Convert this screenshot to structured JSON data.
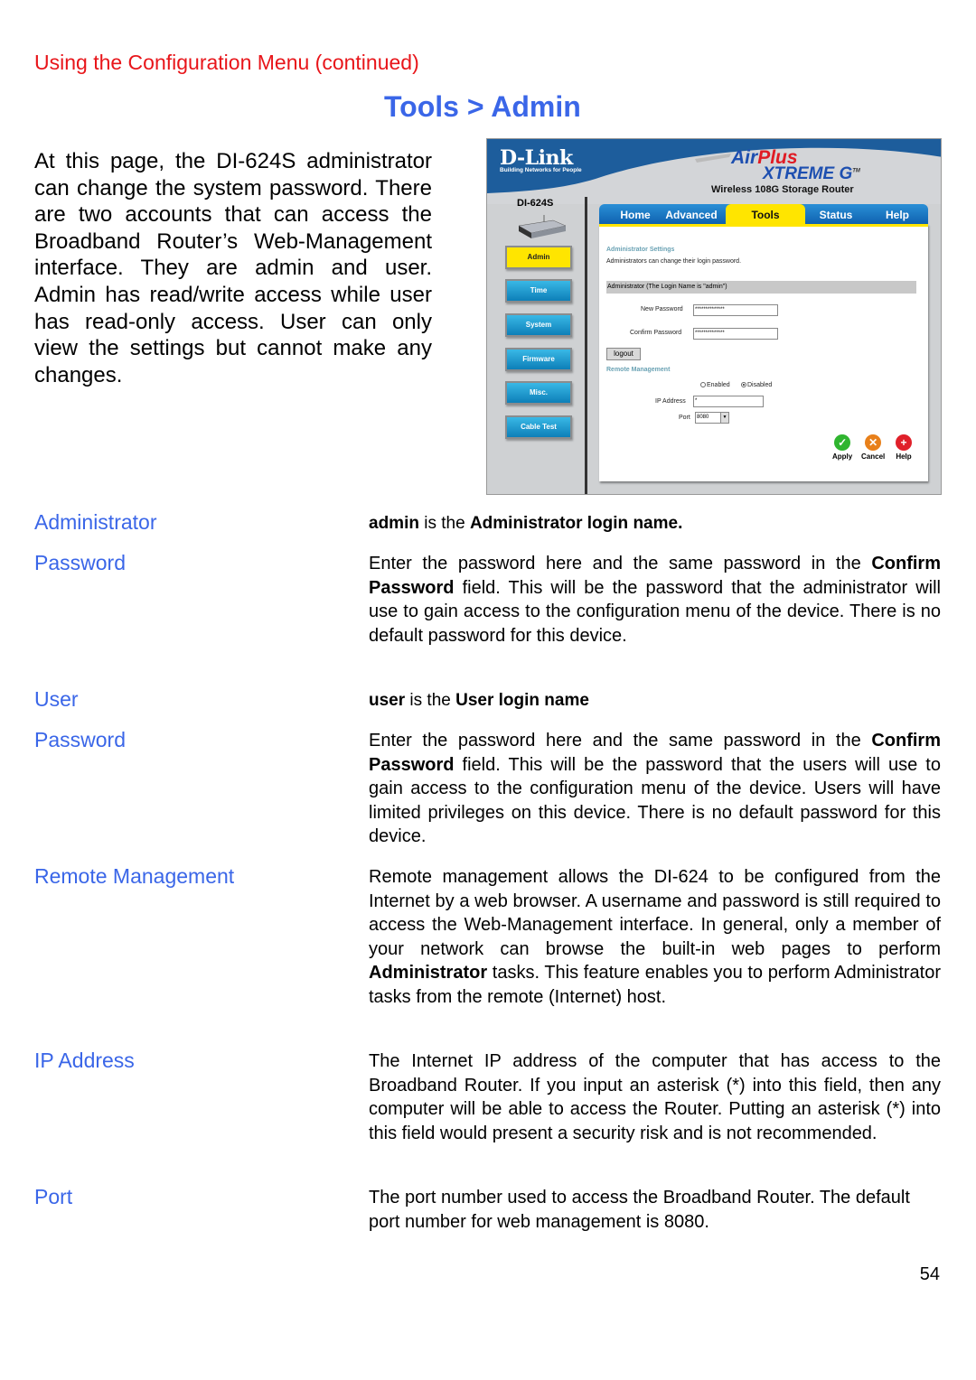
{
  "header": {
    "section": "Using the Configuration Menu (continued)",
    "title": "Tools > Admin"
  },
  "intro": "At this page, the DI-624S administrator can change the system password. There are two accounts that can access the Broadband Router’s Web-Management interface. They are admin and user. Admin has read/write access while user has read-only access. User can only view the settings but cannot make any changes.",
  "router_ui": {
    "brand": "D-Link",
    "brand_tagline": "Building Networks for People",
    "product_line_1a": "Air",
    "product_line_1b": "Plus",
    "product_line_2": "XTREME G",
    "trademark": "TM",
    "product_name": "Wireless 108G Storage Router",
    "model": "DI-624S",
    "tabs": [
      {
        "label": "Home",
        "active": false
      },
      {
        "label": "Advanced",
        "active": false
      },
      {
        "label": "Tools",
        "active": true
      },
      {
        "label": "Status",
        "active": false
      },
      {
        "label": "Help",
        "active": false
      }
    ],
    "side_nav": [
      {
        "label": "Admin",
        "active": true
      },
      {
        "label": "Time",
        "active": false
      },
      {
        "label": "System",
        "active": false
      },
      {
        "label": "Firmware",
        "active": false
      },
      {
        "label": "Misc.",
        "active": false
      },
      {
        "label": "Cable Test",
        "active": false
      }
    ],
    "content": {
      "settings_heading": "Administrator Settings",
      "settings_desc": "Administrators can change their login password.",
      "admin_bar": "Administrator (The Login Name is \"admin\")",
      "new_password_label": "New Password",
      "new_password_value": "**************",
      "confirm_password_label": "Confirm Password",
      "confirm_password_value": "**************",
      "logout_button": "logout",
      "remote_heading": "Remote Management",
      "enabled_label": "Enabled",
      "disabled_label": "Disabled",
      "remote_selected": "Disabled",
      "ip_label": "IP Address",
      "ip_value": "*",
      "port_label": "Port",
      "port_value": "8080",
      "apply": "Apply",
      "cancel": "Cancel",
      "help": "Help"
    }
  },
  "definitions": [
    {
      "term": "Administrator",
      "desc_parts": [
        {
          "b": "admin"
        },
        {
          "t": " is the "
        },
        {
          "b": "Administrator login name."
        }
      ]
    },
    {
      "term": "Password",
      "desc_parts": [
        {
          "t": "Enter the password here and the same password in the "
        },
        {
          "b": "Confirm Password"
        },
        {
          "t": " field. This will be the password that the administrator will use to gain access to the configuration menu of the device. There is no default password for this device."
        }
      ]
    },
    {
      "term": "User",
      "desc_parts": [
        {
          "b": "user"
        },
        {
          "t": " is the "
        },
        {
          "b": "User login name"
        }
      ]
    },
    {
      "term": "Password",
      "desc_parts": [
        {
          "t": "Enter the password here and the same password in the "
        },
        {
          "b": "Confirm Password"
        },
        {
          "t": " field. This will be the password that the users will use to gain access to the configuration menu of the device. Users will have limited privileges on this device. There is no default password for this device."
        }
      ]
    },
    {
      "term": "Remote Management",
      "desc_parts": [
        {
          "t": "Remote management allows the DI-624 to be configured from the Internet by a web browser. A username and password is still required to access the Web-Management interface. In general, only a member of your network can browse the built-in web pages to perform "
        },
        {
          "b": "Administrator"
        },
        {
          "t": " tasks. This feature enables you to perform Administrator tasks from the remote (Internet) host."
        }
      ]
    },
    {
      "term": "IP Address",
      "desc_parts": [
        {
          "t": "The Internet IP address of the computer that has access to the Broadband Router. If you input an asterisk (*) into this field, then any computer will be able to access the Router. Putting an asterisk (*) into this field would present a security risk and is not recommended."
        }
      ]
    },
    {
      "term": "Port",
      "desc_parts": [
        {
          "t": "The port number used to access the Broadband Router. The default port number for web management is 8080."
        }
      ]
    }
  ],
  "page_number": "54"
}
